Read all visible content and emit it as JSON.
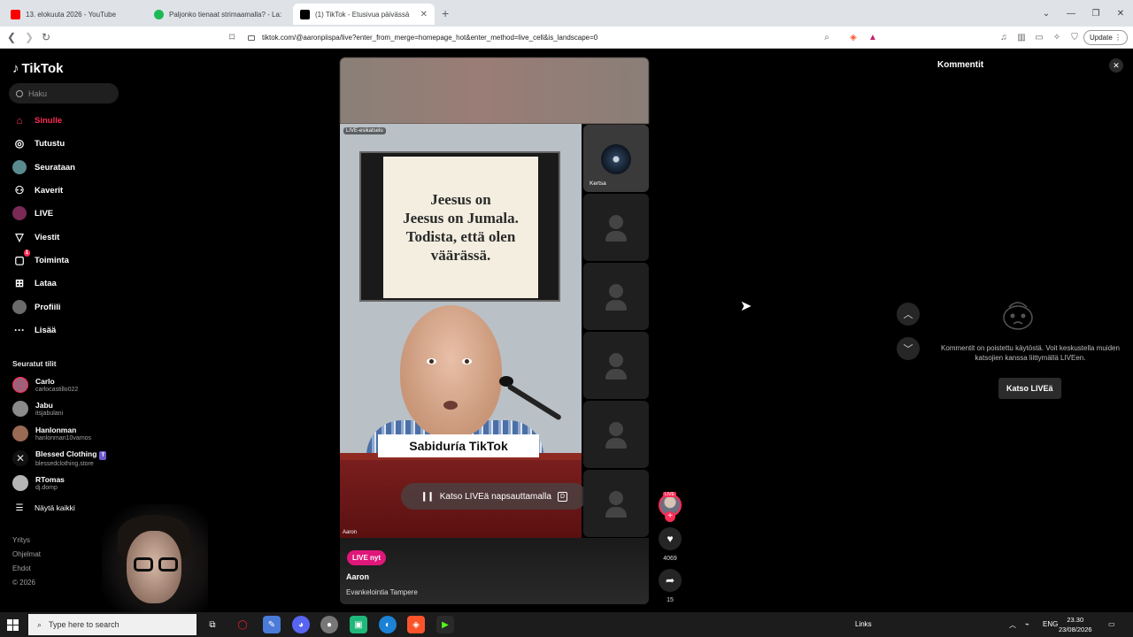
{
  "browser": {
    "tabs": [
      {
        "title": "13. elokuuta 2026 - YouTube",
        "active": false,
        "favicon_color": "#ff0000"
      },
      {
        "title": "Paljonko tienaat strimaamalla? - La:",
        "active": false,
        "favicon_color": "#1db954"
      },
      {
        "title": "(1) TikTok - Etusivua päivässä",
        "active": true,
        "favicon_color": "#000000"
      }
    ],
    "url": "tiktok.com/@aaronpiispa/live?enter_from_merge=homepage_hot&enter_method=live_cell&is_landscape=0",
    "update_label": "Update"
  },
  "tiktok": {
    "logo": "TikTok",
    "search_placeholder": "Haku",
    "nav": [
      {
        "label": "Sinulle",
        "icon": "home-icon",
        "active": true
      },
      {
        "label": "Tutustu",
        "icon": "compass-icon"
      },
      {
        "label": "Seurataan",
        "icon": "following-icon"
      },
      {
        "label": "Kaverit",
        "icon": "friends-icon"
      },
      {
        "label": "LIVE",
        "icon": "live-icon"
      },
      {
        "label": "Viestit",
        "icon": "messages-icon"
      },
      {
        "label": "Toiminta",
        "icon": "activity-icon",
        "badge": "1"
      },
      {
        "label": "Lataa",
        "icon": "upload-icon"
      },
      {
        "label": "Profiili",
        "icon": "profile-icon"
      },
      {
        "label": "Lisää",
        "icon": "more-icon"
      }
    ],
    "followed_title": "Seuratut tilit",
    "followed": [
      {
        "name": "Carlo",
        "handle": "carlocastillo022"
      },
      {
        "name": "Jabu",
        "handle": "itsjabulani"
      },
      {
        "name": "Hanlonman",
        "handle": "hanlonman10vamos"
      },
      {
        "name": "Blessed Clothing",
        "handle": "blessedclothing.store",
        "verified": true
      },
      {
        "name": "RTomas",
        "handle": "dj.domp"
      }
    ],
    "show_all": "Näytä kaikki",
    "footer": [
      "Yritys",
      "Ohjelmat",
      "Ehdot",
      "© 2026"
    ]
  },
  "stream": {
    "live_chip": "LIVE-esikatselu",
    "board_text": "Jeesus on\nJeesus on Jumala.\nTodista, että olen\nväärässä.",
    "caption_label": "Sabiduría TikTok",
    "watch_prompt": "Katso LIVEä napsauttamalla",
    "watch_key": "D",
    "host_tag": "Aaron",
    "guests": [
      {
        "name": "Kertsa",
        "has_avatar": true
      },
      {
        "name": "",
        "has_avatar": false
      },
      {
        "name": "",
        "has_avatar": false
      },
      {
        "name": "",
        "has_avatar": false
      },
      {
        "name": "",
        "has_avatar": false
      },
      {
        "name": "",
        "has_avatar": false
      }
    ],
    "live_now": "LIVE nyt",
    "host_name": "Aaron",
    "host_desc": "Evankelointia Tampere",
    "live_badge": "LIVE",
    "likes": "4069",
    "shares": "15"
  },
  "comments": {
    "title": "Kommentit",
    "empty_message": "Kommentit on poistettu käytöstä. Voit keskustella muiden katsojien kanssa liittymällä LIVEen.",
    "button": "Katso LIVEä"
  },
  "taskbar": {
    "search_placeholder": "Type here to search",
    "links": "Links",
    "lang": "ENG",
    "time": "23.30",
    "date": "23/08/2026"
  },
  "colors": {
    "accent": "#fe2c55",
    "live_pink": "#e0177a"
  }
}
